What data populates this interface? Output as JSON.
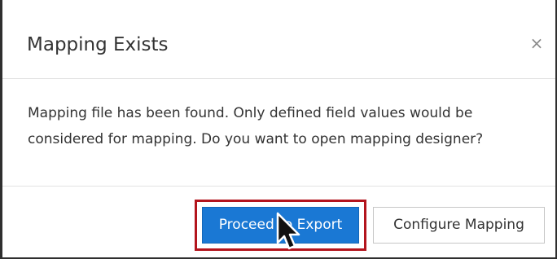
{
  "dialog": {
    "title": "Mapping Exists",
    "close_label": "×",
    "message": "Mapping file has been found. Only defined field values would be considered for mapping. Do you want to open mapping designer?",
    "buttons": {
      "proceed_label": "Proceed to Export",
      "configure_label": "Configure Mapping"
    }
  },
  "colors": {
    "primary": "#1a78d4",
    "highlight": "#b3141d"
  },
  "icons": {
    "close": "close-icon",
    "cursor": "mouse-pointer-icon"
  }
}
